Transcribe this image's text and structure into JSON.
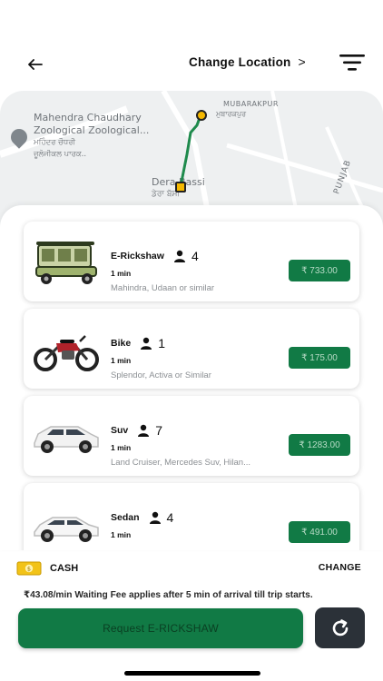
{
  "header": {
    "back_icon": "arrow-left-icon",
    "change_location_label": "Change Location",
    "chevron": ">",
    "filter_icon": "filter-icon"
  },
  "map": {
    "labels": {
      "mubarakpur": "MUBARAKPUR",
      "mubarakpur_punjabi": "ਮੁਬਾਰਕਪੁਰ",
      "zoo_line1": "Mahendra Chaudhary",
      "zoo_line2": "Zoological Zoological...",
      "zoo_punjabi1": "ਮਹਿੰਦਰ ਚੌਧਰੀ",
      "zoo_punjabi2": "ਜ਼ੂਲੋਜੀਕਲ ਪਾਰਕ..",
      "dera_bassi": "Dera Bassi",
      "dera_bassi_punjabi": "ਡੇਰਾ ਬੱਸੀ",
      "punjab": "PUNJAB"
    },
    "route_color": "#1e8a4c",
    "pin_color": "#f5b800"
  },
  "vehicles": [
    {
      "name": "E-Rickshaw",
      "capacity": "4",
      "eta": "1 min",
      "models": "Mahindra, Udaan or similar",
      "price": "₹ 733.00",
      "icon": "e-rickshaw-image"
    },
    {
      "name": "Bike",
      "capacity": "1",
      "eta": "1 min",
      "models": "Splendor, Activa or Similar",
      "price": "₹ 175.00",
      "icon": "bike-image"
    },
    {
      "name": "Suv",
      "capacity": "7",
      "eta": "1 min",
      "models": "Land Cruiser, Mercedes Suv, Hilan...",
      "price": "₹ 1283.00",
      "icon": "suv-image"
    },
    {
      "name": "Sedan",
      "capacity": "4",
      "eta": "1 min",
      "models": "",
      "price": "₹ 491.00",
      "icon": "sedan-image"
    }
  ],
  "payment": {
    "method": "CASH",
    "change_label": "CHANGE",
    "icon": "cash-icon"
  },
  "fee_note": "₹43.08/min Waiting Fee applies after 5 min of arrival till trip starts.",
  "request_button_label": "Request E-RICKSHAW",
  "refresh_icon": "refresh-icon",
  "colors": {
    "brand_green": "#117a45",
    "price_text": "#b8dbc6",
    "dark_button": "#2b3138"
  }
}
